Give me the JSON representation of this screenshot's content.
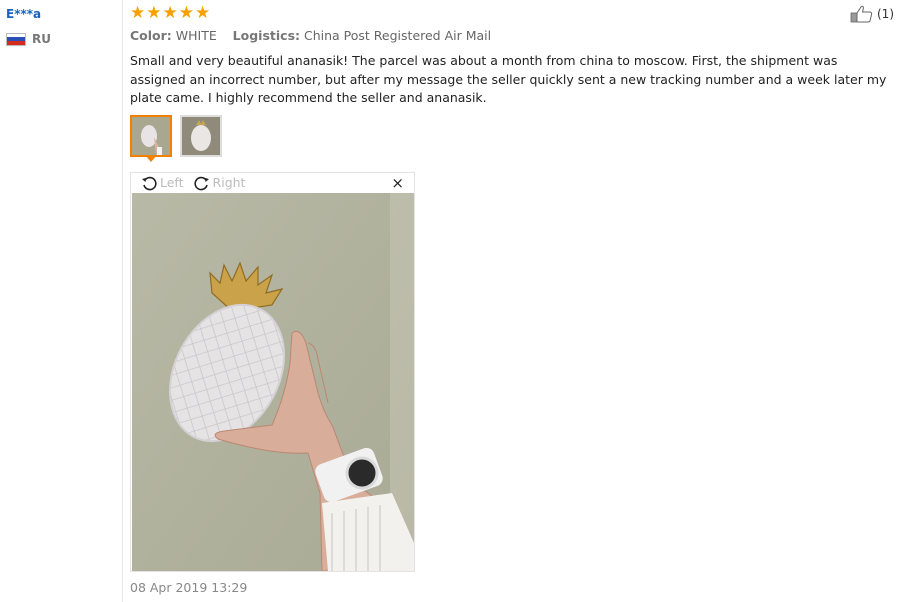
{
  "user": {
    "name": "E***a",
    "country": "RU"
  },
  "rating": {
    "stars": 5
  },
  "helpful": {
    "count": "(1)"
  },
  "meta": {
    "color_label": "Color:",
    "color_value": "WHITE",
    "logistics_label": "Logistics:",
    "logistics_value": "China Post Registered Air Mail"
  },
  "review": {
    "text": "Small and very beautiful ananasik! The parcel was about a month from china to moscow. First, the shipment was assigned an incorrect number, but after my message the seller quickly sent a new tracking number and a week later my plate came. I highly recommend the seller and ananasik."
  },
  "viewer": {
    "rotate_left": "Left",
    "rotate_right": "Right",
    "close": "×"
  },
  "date": "08 Apr 2019 13:29",
  "colors": {
    "link": "#1664c0",
    "star": "#f5a100",
    "accent": "#f08200"
  }
}
